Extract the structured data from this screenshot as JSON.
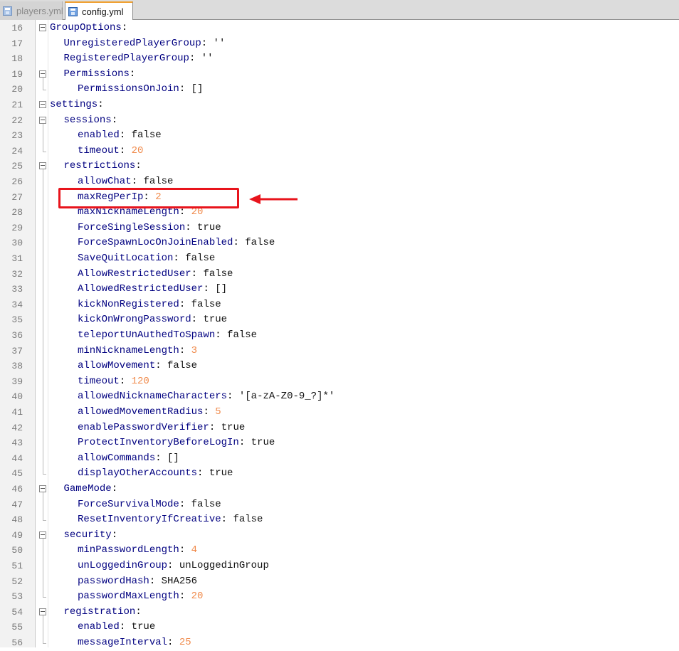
{
  "tabs": [
    {
      "label": "players.yml",
      "active": false
    },
    {
      "label": "config.yml",
      "active": true
    }
  ],
  "colors": {
    "key": "#000080",
    "number": "#f08a4b",
    "annotation_red": "#e8141c"
  },
  "lines": [
    {
      "n": "16",
      "indent": 0,
      "key": "GroupOptions",
      "value": "",
      "vtype": "plain"
    },
    {
      "n": "17",
      "indent": 1,
      "key": "UnregisteredPlayerGroup",
      "value": "''",
      "vtype": "plain"
    },
    {
      "n": "18",
      "indent": 1,
      "key": "RegisteredPlayerGroup",
      "value": "''",
      "vtype": "plain"
    },
    {
      "n": "19",
      "indent": 1,
      "key": "Permissions",
      "value": "",
      "vtype": "plain"
    },
    {
      "n": "20",
      "indent": 2,
      "key": "PermissionsOnJoin",
      "value": "[]",
      "vtype": "plain"
    },
    {
      "n": "21",
      "indent": 0,
      "key": "settings",
      "value": "",
      "vtype": "plain"
    },
    {
      "n": "22",
      "indent": 1,
      "key": "sessions",
      "value": "",
      "vtype": "plain"
    },
    {
      "n": "23",
      "indent": 2,
      "key": "enabled",
      "value": "false",
      "vtype": "plain"
    },
    {
      "n": "24",
      "indent": 2,
      "key": "timeout",
      "value": "20",
      "vtype": "num"
    },
    {
      "n": "25",
      "indent": 1,
      "key": "restrictions",
      "value": "",
      "vtype": "plain"
    },
    {
      "n": "26",
      "indent": 2,
      "key": "allowChat",
      "value": "false",
      "vtype": "plain"
    },
    {
      "n": "27",
      "indent": 2,
      "key": "maxRegPerIp",
      "value": "2",
      "vtype": "num"
    },
    {
      "n": "28",
      "indent": 2,
      "key": "maxNicknameLength",
      "value": "20",
      "vtype": "num"
    },
    {
      "n": "29",
      "indent": 2,
      "key": "ForceSingleSession",
      "value": "true",
      "vtype": "plain"
    },
    {
      "n": "30",
      "indent": 2,
      "key": "ForceSpawnLocOnJoinEnabled",
      "value": "false",
      "vtype": "plain"
    },
    {
      "n": "31",
      "indent": 2,
      "key": "SaveQuitLocation",
      "value": "false",
      "vtype": "plain"
    },
    {
      "n": "32",
      "indent": 2,
      "key": "AllowRestrictedUser",
      "value": "false",
      "vtype": "plain"
    },
    {
      "n": "33",
      "indent": 2,
      "key": "AllowedRestrictedUser",
      "value": "[]",
      "vtype": "plain"
    },
    {
      "n": "34",
      "indent": 2,
      "key": "kickNonRegistered",
      "value": "false",
      "vtype": "plain"
    },
    {
      "n": "35",
      "indent": 2,
      "key": "kickOnWrongPassword",
      "value": "true",
      "vtype": "plain"
    },
    {
      "n": "36",
      "indent": 2,
      "key": "teleportUnAuthedToSpawn",
      "value": "false",
      "vtype": "plain"
    },
    {
      "n": "37",
      "indent": 2,
      "key": "minNicknameLength",
      "value": "3",
      "vtype": "num"
    },
    {
      "n": "38",
      "indent": 2,
      "key": "allowMovement",
      "value": "false",
      "vtype": "plain"
    },
    {
      "n": "39",
      "indent": 2,
      "key": "timeout",
      "value": "120",
      "vtype": "num"
    },
    {
      "n": "40",
      "indent": 2,
      "key": "allowedNicknameCharacters",
      "value": "'[a-zA-Z0-9_?]*'",
      "vtype": "plain"
    },
    {
      "n": "41",
      "indent": 2,
      "key": "allowedMovementRadius",
      "value": "5",
      "vtype": "num"
    },
    {
      "n": "42",
      "indent": 2,
      "key": "enablePasswordVerifier",
      "value": "true",
      "vtype": "plain"
    },
    {
      "n": "43",
      "indent": 2,
      "key": "ProtectInventoryBeforeLogIn",
      "value": "true",
      "vtype": "plain"
    },
    {
      "n": "44",
      "indent": 2,
      "key": "allowCommands",
      "value": "[]",
      "vtype": "plain"
    },
    {
      "n": "45",
      "indent": 2,
      "key": "displayOtherAccounts",
      "value": "true",
      "vtype": "plain"
    },
    {
      "n": "46",
      "indent": 1,
      "key": "GameMode",
      "value": "",
      "vtype": "plain"
    },
    {
      "n": "47",
      "indent": 2,
      "key": "ForceSurvivalMode",
      "value": "false",
      "vtype": "plain"
    },
    {
      "n": "48",
      "indent": 2,
      "key": "ResetInventoryIfCreative",
      "value": "false",
      "vtype": "plain"
    },
    {
      "n": "49",
      "indent": 1,
      "key": "security",
      "value": "",
      "vtype": "plain"
    },
    {
      "n": "50",
      "indent": 2,
      "key": "minPasswordLength",
      "value": "4",
      "vtype": "num"
    },
    {
      "n": "51",
      "indent": 2,
      "key": "unLoggedinGroup",
      "value": "unLoggedinGroup",
      "vtype": "plain"
    },
    {
      "n": "52",
      "indent": 2,
      "key": "passwordHash",
      "value": "SHA256",
      "vtype": "plain"
    },
    {
      "n": "53",
      "indent": 2,
      "key": "passwordMaxLength",
      "value": "20",
      "vtype": "num"
    },
    {
      "n": "54",
      "indent": 1,
      "key": "registration",
      "value": "",
      "vtype": "plain"
    },
    {
      "n": "55",
      "indent": 2,
      "key": "enabled",
      "value": "true",
      "vtype": "plain"
    },
    {
      "n": "56",
      "indent": 2,
      "key": "messageInterval",
      "value": "25",
      "vtype": "num"
    }
  ]
}
